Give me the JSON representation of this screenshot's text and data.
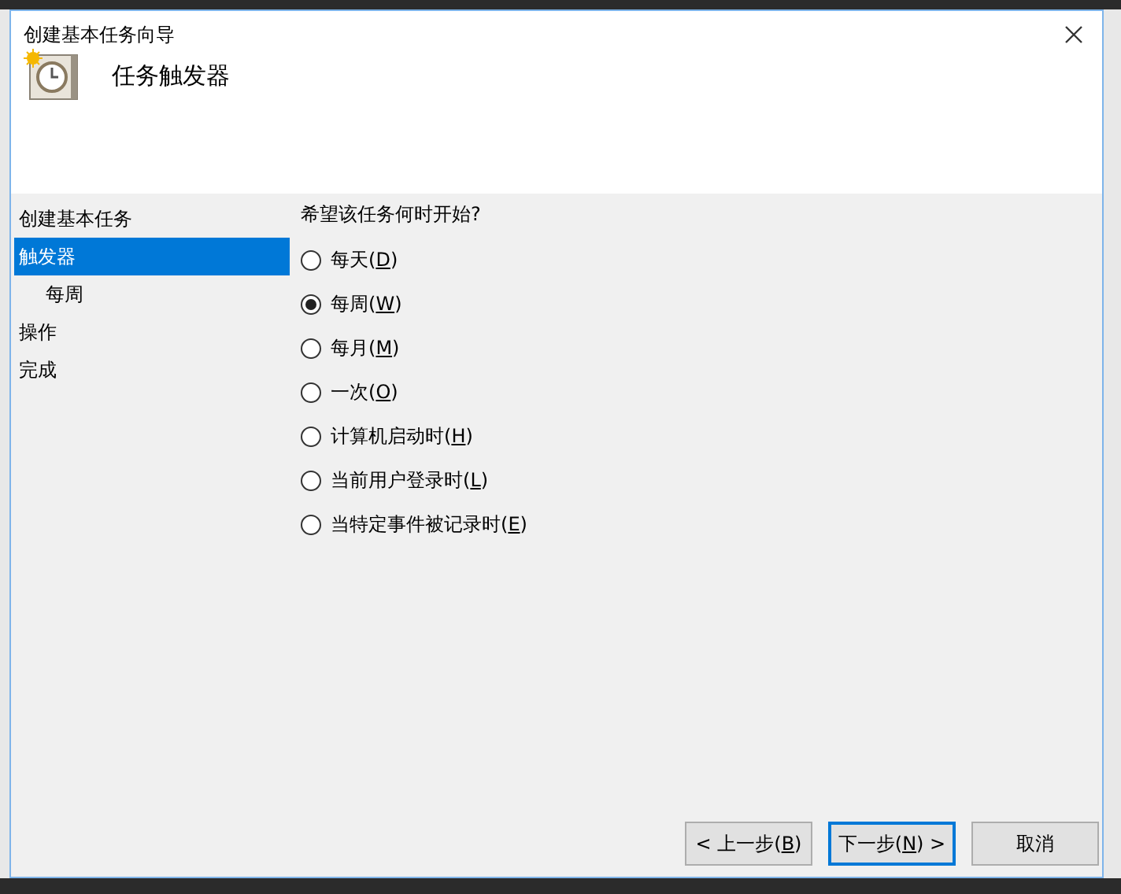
{
  "window": {
    "title": "创建基本任务向导"
  },
  "header": {
    "title": "任务触发器"
  },
  "steps": [
    {
      "label": "创建基本任务",
      "selected": false
    },
    {
      "label": "触发器",
      "selected": true,
      "children": [
        {
          "label": "每周",
          "selected": false
        }
      ]
    },
    {
      "label": "操作",
      "selected": false
    },
    {
      "label": "完成",
      "selected": false
    }
  ],
  "question": "希望该任务何时开始?",
  "options": [
    {
      "label": "每天(D)",
      "selected": false
    },
    {
      "label": "每周(W)",
      "selected": true
    },
    {
      "label": "每月(M)",
      "selected": false
    },
    {
      "label": "一次(O)",
      "selected": false
    },
    {
      "label": "计算机启动时(H)",
      "selected": false
    },
    {
      "label": "当前用户登录时(L)",
      "selected": false
    },
    {
      "label": "当特定事件被记录时(E)",
      "selected": false
    }
  ],
  "buttons": [
    {
      "label": "< 上一步(B)",
      "default": false
    },
    {
      "label": "下一步(N) >",
      "default": true
    },
    {
      "label": "取消",
      "default": false
    }
  ]
}
